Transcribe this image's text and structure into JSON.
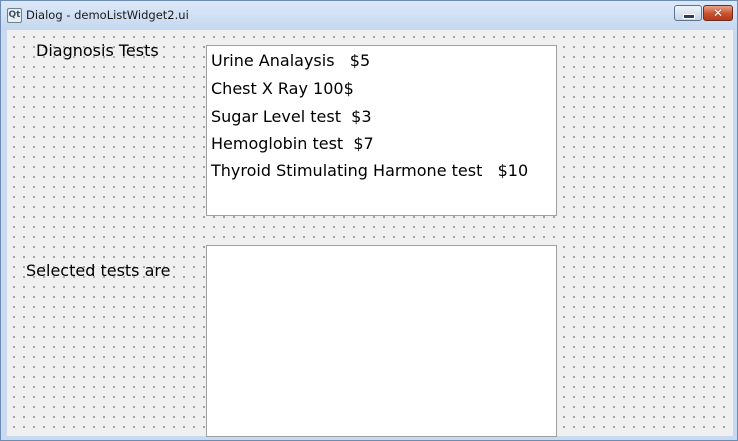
{
  "window": {
    "title": "Dialog - demoListWidget2.ui",
    "icon": "qt-app-icon",
    "icon_glyph": "Qt",
    "minimize_glyph": "",
    "close_glyph": "✕"
  },
  "labels": {
    "diagnosis_tests": "Diagnosis Tests",
    "selected_tests": "Selected tests are"
  },
  "diagnosis_list": {
    "items": [
      "Urine Analaysis   $5",
      "Chest X Ray 100$",
      "Sugar Level test  $3",
      "Hemoglobin test  $7",
      "Thyroid Stimulating Harmone test   $10"
    ]
  },
  "selected_list": {
    "items": []
  }
}
